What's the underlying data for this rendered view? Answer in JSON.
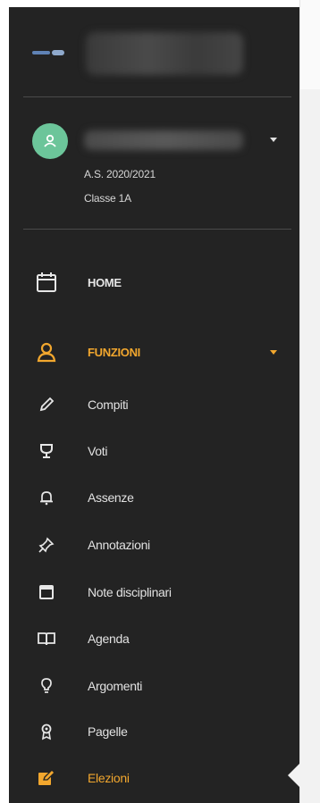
{
  "user": {
    "school_year": "A.S. 2020/2021",
    "class": "Classe 1A"
  },
  "nav": {
    "home": "HOME",
    "funzioni": "FUNZIONI",
    "items": [
      {
        "label": "Compiti",
        "icon": "pencil-icon"
      },
      {
        "label": "Voti",
        "icon": "trophy-icon"
      },
      {
        "label": "Assenze",
        "icon": "bell-icon"
      },
      {
        "label": "Annotazioni",
        "icon": "pin-icon"
      },
      {
        "label": "Note disciplinari",
        "icon": "calendar-window-icon"
      },
      {
        "label": "Agenda",
        "icon": "book-icon"
      },
      {
        "label": "Argomenti",
        "icon": "lightbulb-icon"
      },
      {
        "label": "Pagelle",
        "icon": "award-icon"
      },
      {
        "label": "Elezioni",
        "icon": "vote-edit-icon"
      }
    ]
  },
  "colors": {
    "sidebar_bg": "#232323",
    "accent": "#f2a72e",
    "avatar": "#6cc59a",
    "text": "#e6e6e6"
  }
}
